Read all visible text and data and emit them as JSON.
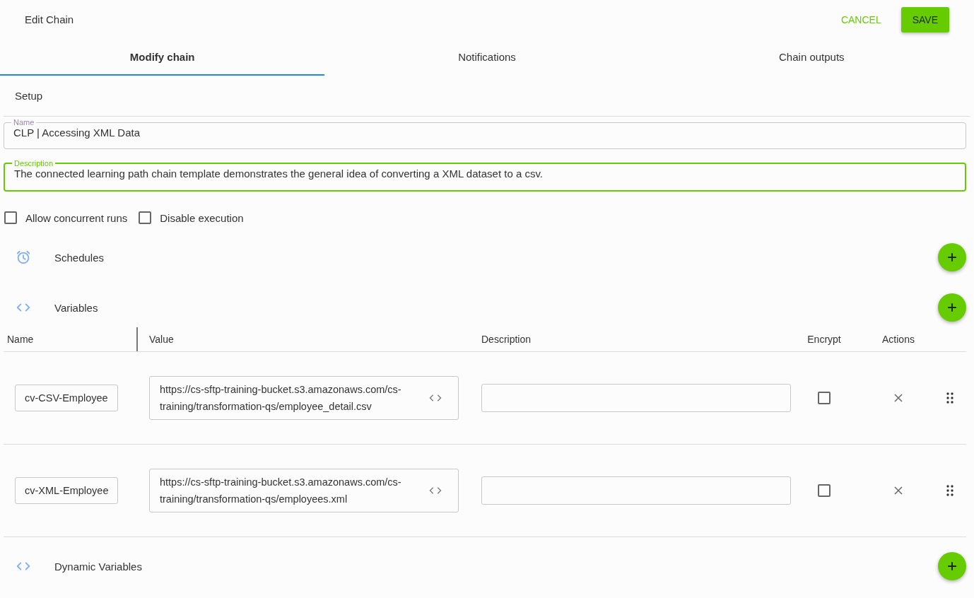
{
  "header": {
    "title": "Edit Chain",
    "cancel": "CANCEL",
    "save": "SAVE"
  },
  "tabs": [
    {
      "label": "Modify chain",
      "selected": true
    },
    {
      "label": "Notifications",
      "selected": false
    },
    {
      "label": "Chain outputs",
      "selected": false
    }
  ],
  "setup": {
    "title": "Setup"
  },
  "fields": [
    {
      "label": "Name",
      "value": "CLP | Accessing XML Data",
      "focused": false
    },
    {
      "label": "Description",
      "value": "The connected learning path chain template demonstrates the general idea of converting a XML dataset to a csv.",
      "focused": true
    }
  ],
  "options": [
    {
      "label": "Allow concurrent runs",
      "checked": false
    },
    {
      "label": "Disable execution",
      "checked": false
    }
  ],
  "sections": [
    {
      "kind": "clock",
      "title": "Schedules"
    },
    {
      "kind": "code",
      "title": "Variables",
      "table": {
        "columns": [
          "Name",
          "Value",
          "Description",
          "Encrypt",
          "Actions"
        ],
        "rows": [
          {
            "name": "cv-CSV-Employee",
            "value": "https://cs-sftp-training-bucket.s3.amazonaws.com/cs-training/transformation-qs/employee_detail.csv",
            "encrypt": false
          },
          {
            "name": "cv-XML-Employee",
            "value": "https://cs-sftp-training-bucket.s3.amazonaws.com/cs-training/transformation-qs/employees.xml",
            "encrypt": false
          }
        ]
      }
    },
    {
      "kind": "code",
      "title": "Dynamic Variables"
    }
  ]
}
